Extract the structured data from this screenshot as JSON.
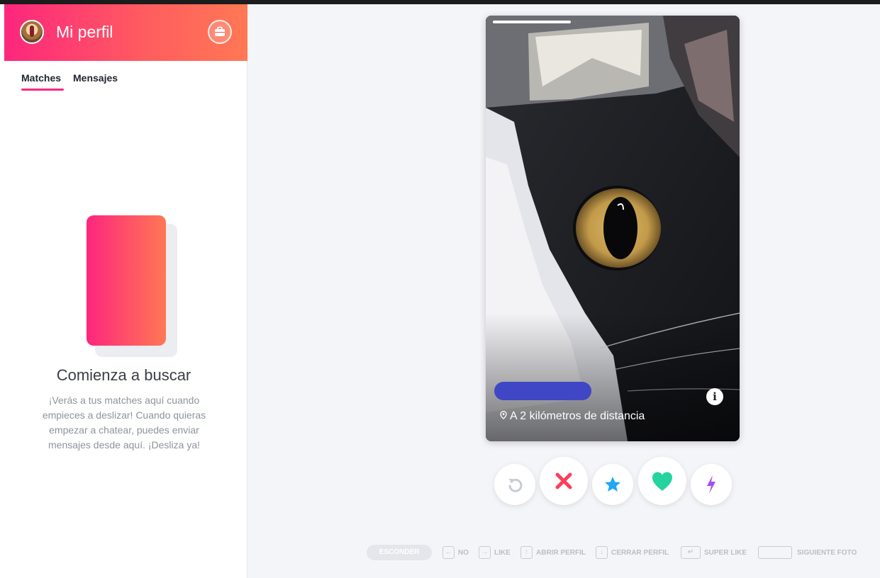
{
  "sidebar": {
    "profile_title": "Mi perfil",
    "tabs": [
      {
        "label": "Matches",
        "active": true
      },
      {
        "label": "Mensajes",
        "active": false
      }
    ],
    "empty_state": {
      "title": "Comienza a buscar",
      "text": "¡Verás a tus matches aquí cuando empieces a deslizar! Cuando quieras empezar a chatear, puedes enviar mensajes desde aquí. ¡Desliza ya!"
    }
  },
  "card": {
    "distance": "A 2 kilómetros de distancia",
    "info_icon": "i"
  },
  "actions": [
    {
      "name": "rewind",
      "icon": "rewind-icon",
      "color": "#c7ccd4"
    },
    {
      "name": "nope",
      "icon": "x-icon",
      "color": "#fd3f5c"
    },
    {
      "name": "super-like",
      "icon": "star-icon",
      "color": "#21a7f5"
    },
    {
      "name": "like",
      "icon": "heart-icon",
      "color": "#24d39e"
    },
    {
      "name": "boost",
      "icon": "bolt-icon",
      "color": "#a64cf0"
    }
  ],
  "shortcuts": {
    "hide": "ESCONDER",
    "no": "NO",
    "like": "LIKE",
    "open_profile": "ABRIR PERFIL",
    "close_profile": "CERRAR PERFIL",
    "super_like": "SUPER LIKE",
    "next_photo": "SIGUIENTE FOTO"
  },
  "colors": {
    "brand_start": "#fd267d",
    "brand_end": "#ff7854"
  }
}
